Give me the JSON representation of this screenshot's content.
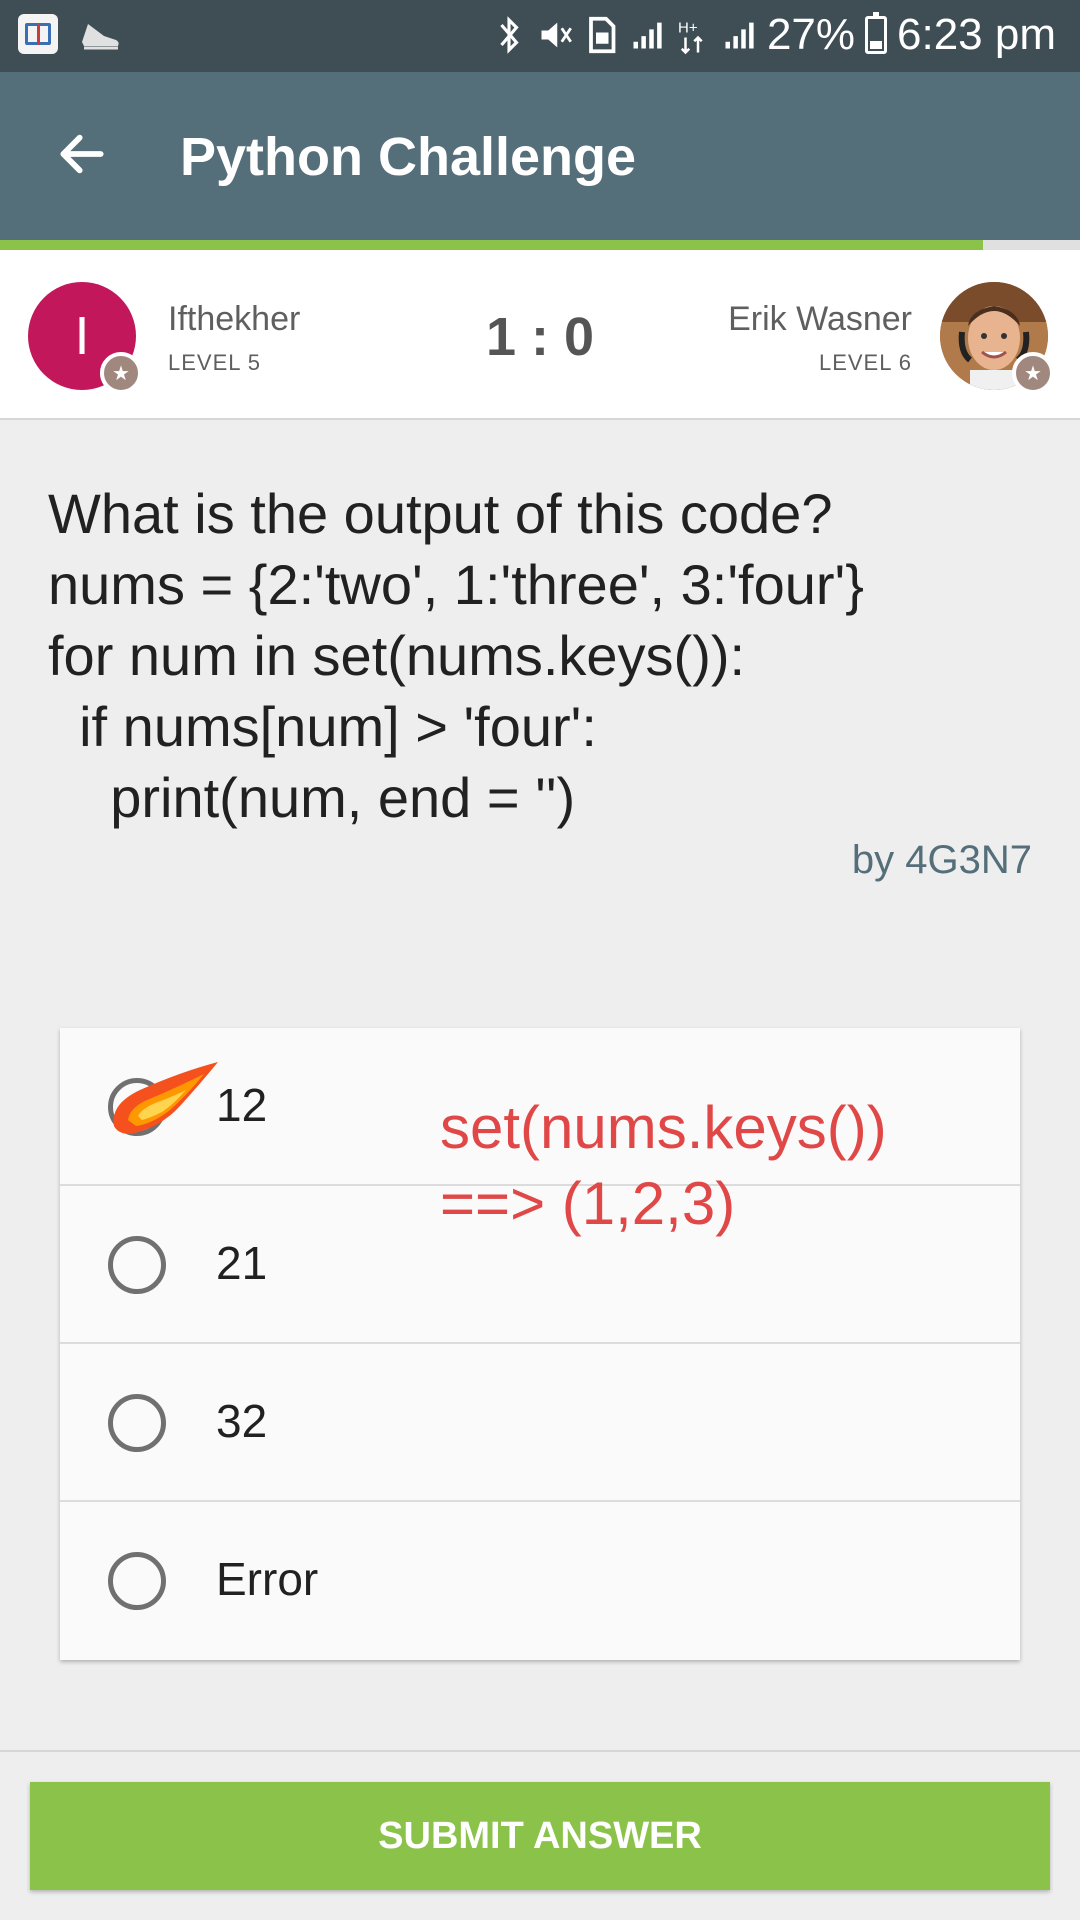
{
  "status_bar": {
    "battery_percent": "27%",
    "time": "6:23 pm",
    "icons": [
      "book-app-icon",
      "shoe-app-icon",
      "bluetooth-icon",
      "mute-vibrate-icon",
      "sim-icon",
      "signal-icon",
      "data-icon",
      "signal-icon",
      "battery-icon"
    ]
  },
  "app_bar": {
    "title": "Python Challenge",
    "back_icon": "arrow-left-icon"
  },
  "progress": {
    "fraction": 0.91,
    "color": "#8bc34a"
  },
  "players": {
    "left": {
      "initial": "I",
      "name": "Ifthekher",
      "level": "LEVEL 5",
      "avatar_color": "#c2185b"
    },
    "right": {
      "name": "Erik Wasner",
      "level": "LEVEL 6"
    },
    "score": "1 : 0"
  },
  "question": {
    "lines": [
      "What is the output of this code?",
      "nums = {2:'two', 1:'three', 3:'four'}",
      "for num in set(nums.keys()):",
      "  if nums[num] > 'four':",
      "    print(num, end = '')"
    ],
    "author": "by 4G3N7"
  },
  "options": [
    {
      "label": "12",
      "selected": true
    },
    {
      "label": "21",
      "selected": false
    },
    {
      "label": "32",
      "selected": false
    },
    {
      "label": "Error",
      "selected": false
    }
  ],
  "annotation": {
    "line1": "set(nums.keys())",
    "line2": "==> (1,2,3)",
    "color": "#e04848"
  },
  "submit_label": "SUBMIT ANSWER",
  "colors": {
    "status_bar": "#3f4e55",
    "app_bar": "#546e7a",
    "accent_green": "#8bc34a"
  }
}
